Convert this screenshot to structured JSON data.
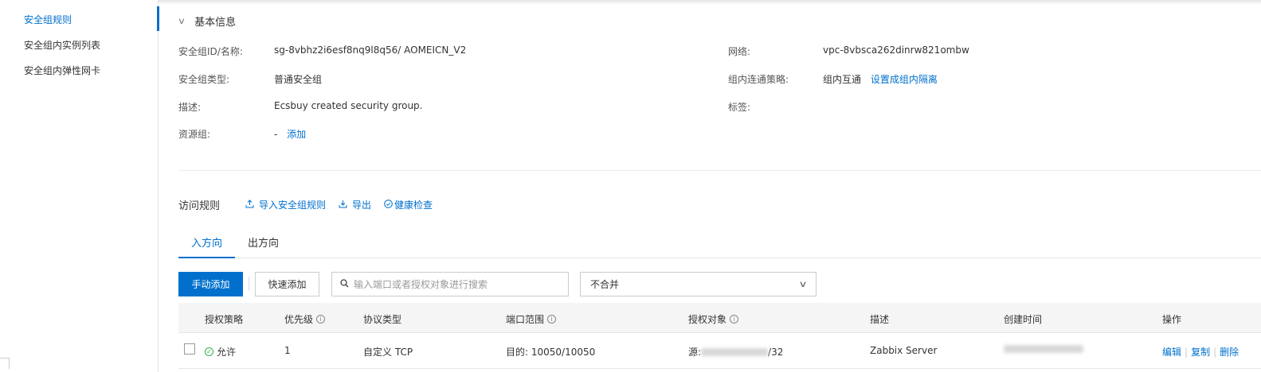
{
  "sidebar": {
    "items": [
      {
        "label": "安全组规则",
        "active": true
      },
      {
        "label": "安全组内实例列表",
        "active": false
      },
      {
        "label": "安全组内弹性网卡",
        "active": false
      }
    ]
  },
  "basic_info": {
    "section_title": "基本信息",
    "left": [
      {
        "label": "安全组ID/名称:",
        "value": "sg-8vbhz2i6esf8nq9l8q56/ AOMEICN_V2"
      },
      {
        "label": "安全组类型:",
        "value": "普通安全组"
      },
      {
        "label": "描述:",
        "value": "Ecsbuy created security group."
      },
      {
        "label": "资源组:",
        "value": "-",
        "link": "添加"
      }
    ],
    "right": [
      {
        "label": "网络:",
        "value": "vpc-8vbsca262dinrw821ombw"
      },
      {
        "label": "组内连通策略:",
        "value": "组内互通",
        "link": "设置成组内隔离"
      },
      {
        "label": "标签:",
        "value": ""
      }
    ]
  },
  "rules": {
    "title": "访问规则",
    "actions": [
      {
        "icon": "upload-icon",
        "label": "导入安全组规则"
      },
      {
        "icon": "download-icon",
        "label": "导出"
      },
      {
        "icon": "shield-check-icon",
        "label": "健康检查"
      }
    ],
    "tabs": [
      {
        "label": "入方向",
        "active": true
      },
      {
        "label": "出方向",
        "active": false
      }
    ],
    "toolbar": {
      "manual_add": "手动添加",
      "quick_add": "快速添加",
      "search_placeholder": "输入端口或者授权对象进行搜索",
      "merge_select": "不合并"
    },
    "columns": [
      "授权策略",
      "优先级",
      "协议类型",
      "端口范围",
      "授权对象",
      "描述",
      "创建时间",
      "操作"
    ],
    "rows": [
      {
        "policy": "允许",
        "priority": "1",
        "protocol": "自定义 TCP",
        "port_range": "目的: 10050/10050",
        "target_prefix": "源:",
        "target_suffix": "/32",
        "description": "Zabbix Server",
        "ops": [
          "编辑",
          "复制",
          "删除"
        ]
      }
    ]
  },
  "colors": {
    "accent": "#0070cc",
    "success": "#2fb34a"
  }
}
